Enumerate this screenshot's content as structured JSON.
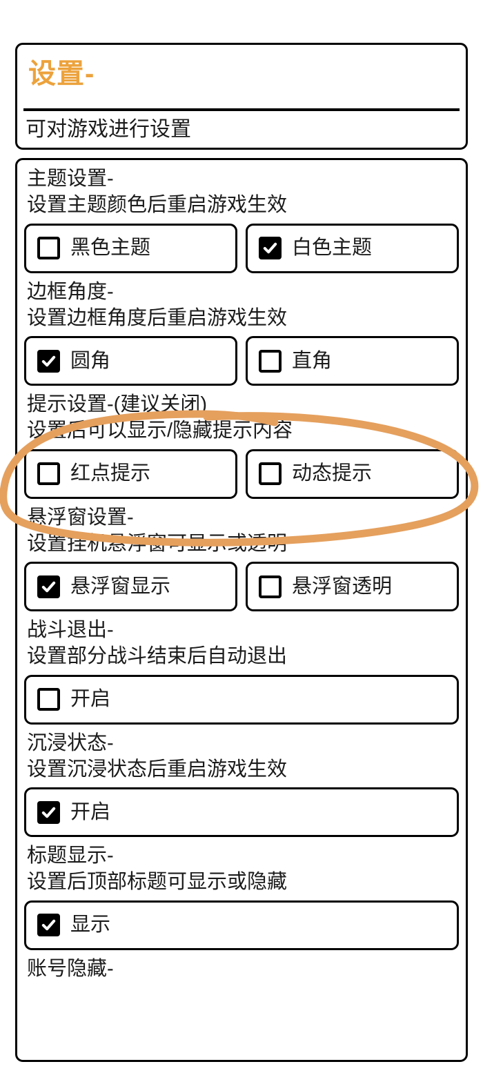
{
  "header": {
    "title": "设置-",
    "subtitle": "可对游戏进行设置",
    "title_color": "#eca23c"
  },
  "annotation": {
    "shape": "hand-drawn-ellipse",
    "color": "#e5a05e",
    "target_section": "提示设置-(建议关闭)"
  },
  "sections": [
    {
      "title": "主题设置-",
      "desc": "设置主题颜色后重启游戏生效",
      "options": [
        {
          "label": "黑色主题",
          "checked": false
        },
        {
          "label": "白色主题",
          "checked": true
        }
      ]
    },
    {
      "title": "边框角度-",
      "desc": "设置边框角度后重启游戏生效",
      "options": [
        {
          "label": "圆角",
          "checked": true
        },
        {
          "label": "直角",
          "checked": false
        }
      ]
    },
    {
      "title": "提示设置-(建议关闭)",
      "desc": "设置后可以显示/隐藏提示内容",
      "options": [
        {
          "label": "红点提示",
          "checked": false
        },
        {
          "label": "动态提示",
          "checked": false
        }
      ]
    },
    {
      "title": "悬浮窗设置-",
      "desc": "设置挂机悬浮窗可显示或透明",
      "options": [
        {
          "label": "悬浮窗显示",
          "checked": true
        },
        {
          "label": "悬浮窗透明",
          "checked": false
        }
      ]
    },
    {
      "title": "战斗退出-",
      "desc": "设置部分战斗结束后自动退出",
      "options": [
        {
          "label": "开启",
          "checked": false
        }
      ]
    },
    {
      "title": "沉浸状态-",
      "desc": "设置沉浸状态后重启游戏生效",
      "options": [
        {
          "label": "开启",
          "checked": true
        }
      ]
    },
    {
      "title": "标题显示-",
      "desc": "设置后顶部标题可显示或隐藏",
      "options": [
        {
          "label": "显示",
          "checked": true
        }
      ]
    },
    {
      "title": "账号隐藏-",
      "desc": "",
      "options": []
    }
  ]
}
